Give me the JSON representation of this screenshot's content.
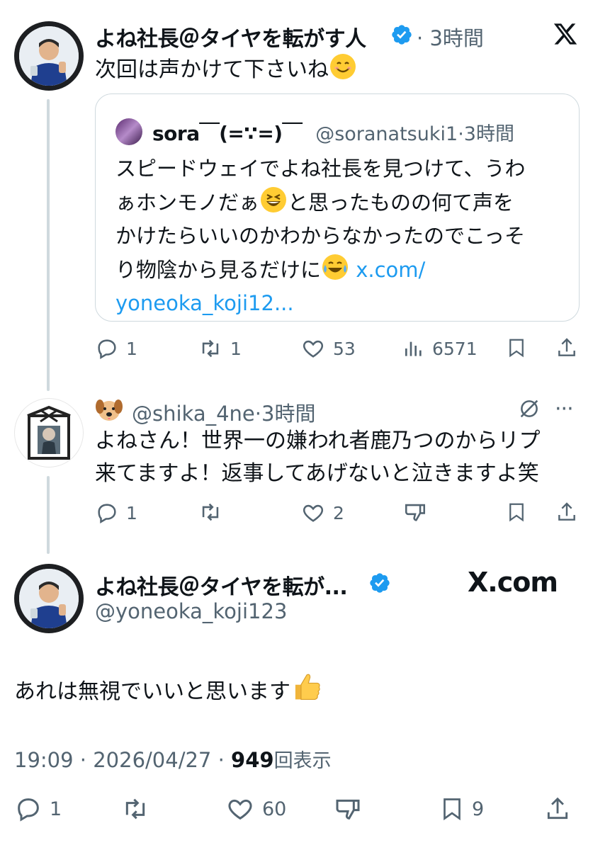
{
  "post1": {
    "display_name": "よね社長＠タイヤを転がす人",
    "time": "3時間",
    "text": "次回は声かけて下さいね"
  },
  "quote": {
    "display_name": "sora￣(=∵=)￣",
    "handle": "@soranatsuki1",
    "time": "3時間",
    "text_line1": "スピードウェイでよね社長を見つけて、うわ",
    "text_line2a": "ぁホンモノだぁ",
    "text_line2b": "と思ったものの何て声を",
    "text_line3": "かけたらいいのかわからなかったのでこっそ",
    "text_line4": "り物陰から見るだけに",
    "link_part1": "x.com/",
    "link_part2": "yoneoka_koji12..."
  },
  "post1_actions": {
    "reply": "1",
    "repost": "1",
    "like": "53",
    "views": "6571"
  },
  "post2": {
    "handle": "@shika_4ne",
    "time": "3時間",
    "text_line1": "よねさん！世界一の嫌われ者鹿乃つのからリプ",
    "text_line2": "来てますよ！返事してあげないと泣きますよ笑"
  },
  "post2_actions": {
    "reply": "1",
    "like": "2"
  },
  "main": {
    "display_name": "よね社長＠タイヤを転が...",
    "handle": "@yoneoka_koji123",
    "brand": "X.com",
    "text": "あれは無視でいいと思います",
    "time": "19:09",
    "date": "2026/04/27",
    "views_count": "949",
    "views_label": "回表示"
  },
  "main_actions": {
    "reply": "1",
    "like": "60",
    "bookmark": "9"
  },
  "colors": {
    "accent": "#1d9bf0",
    "muted": "#536471",
    "text": "#0f1419",
    "border": "#cfd9de"
  }
}
